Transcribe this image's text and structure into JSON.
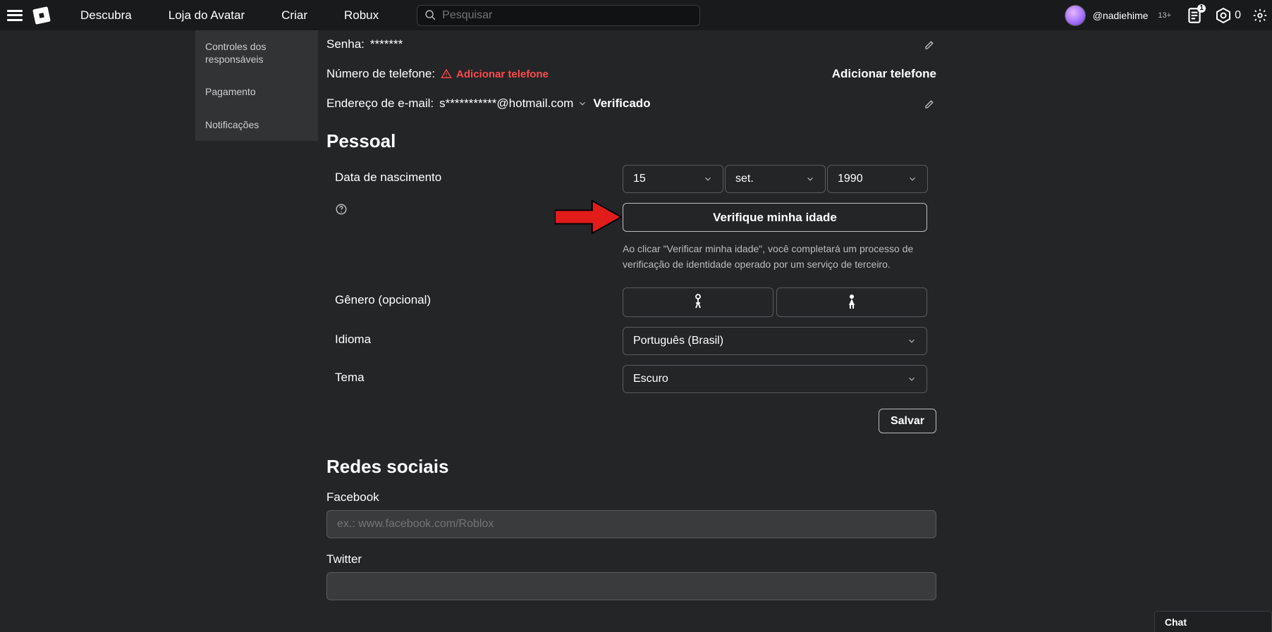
{
  "nav": {
    "links": [
      "Descubra",
      "Loja do Avatar",
      "Criar",
      "Robux"
    ],
    "search_placeholder": "Pesquisar",
    "username": "@nadiehime",
    "age_tag": "13+",
    "notif_count": "1",
    "robux": "0"
  },
  "sidebar": {
    "items": [
      "Controles dos responsáveis",
      "Pagamento",
      "Notificações"
    ]
  },
  "account": {
    "password_label": "Senha:",
    "password_value": "*******",
    "phone_label": "Número de telefone:",
    "phone_add_warn": "Adicionar telefone",
    "phone_add_link": "Adicionar telefone",
    "email_label": "Endereço de e-mail:",
    "email_value": "s***********@hotmail.com",
    "email_verified": "Verificado"
  },
  "personal": {
    "heading": "Pessoal",
    "dob_label": "Data de nascimento",
    "dob_day": "15",
    "dob_month": "set.",
    "dob_year": "1990",
    "verify_button": "Verifique minha idade",
    "verify_desc": "Ao clicar \"Verificar minha idade\", você completará um processo de verificação de identidade operado por um serviço de terceiro.",
    "gender_label": "Gênero (opcional)",
    "language_label": "Idioma",
    "language_value": "Português (Brasil)",
    "theme_label": "Tema",
    "theme_value": "Escuro",
    "save": "Salvar"
  },
  "social": {
    "heading": "Redes sociais",
    "facebook_label": "Facebook",
    "facebook_placeholder": "ex.: www.facebook.com/Roblox",
    "twitter_label": "Twitter"
  },
  "chat": {
    "label": "Chat"
  }
}
